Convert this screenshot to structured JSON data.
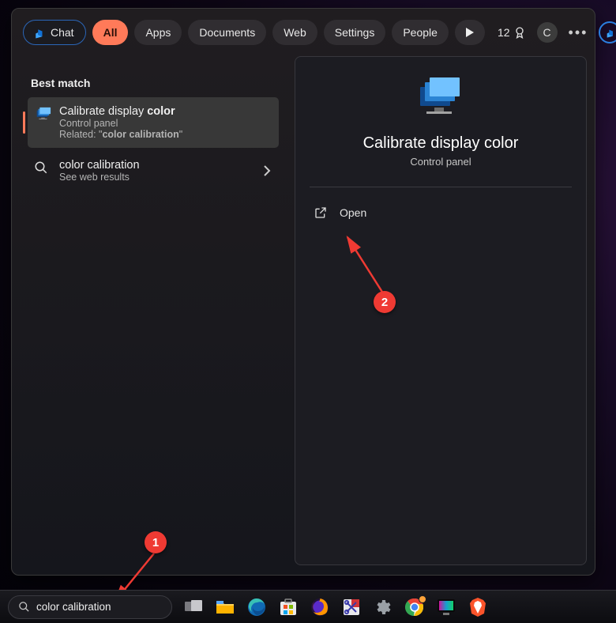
{
  "filters": {
    "chat": "Chat",
    "all": "All",
    "apps": "Apps",
    "documents": "Documents",
    "web": "Web",
    "settings": "Settings",
    "people": "People"
  },
  "top_right": {
    "score": "12",
    "avatar_initial": "C"
  },
  "left": {
    "best_match_label": "Best match",
    "best_match": {
      "title_prefix": "Calibrate display ",
      "title_bold": "color",
      "subtitle": "Control panel",
      "related_prefix": "Related: \"",
      "related_term": "color calibration",
      "related_suffix": "\""
    },
    "web_result": {
      "title": "color calibration",
      "subtitle": "See web results"
    }
  },
  "detail": {
    "title": "Calibrate display color",
    "subtitle": "Control panel",
    "open_label": "Open"
  },
  "taskbar": {
    "search_value": "color calibration"
  },
  "annotations": {
    "badge1": "1",
    "badge2": "2"
  }
}
